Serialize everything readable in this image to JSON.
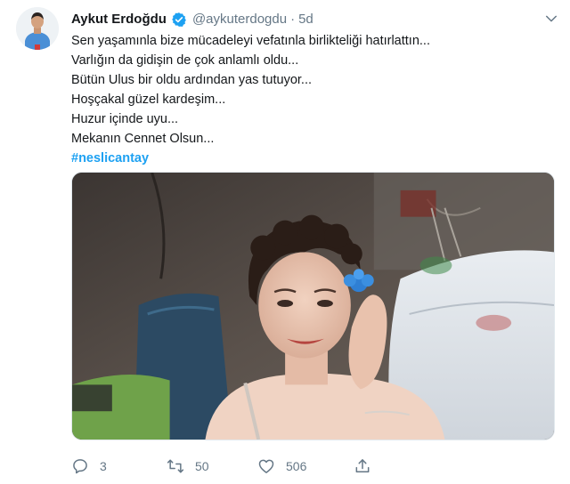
{
  "tweet": {
    "author": {
      "name": "Aykut Erdoğdu",
      "handle": "@aykuterdogdu",
      "verified": true,
      "avatar_icon": "person-avatar-icon"
    },
    "separator": "·",
    "time": "5d",
    "text_lines": [
      "Sen yaşamınla bize mücadeleyi vefatınla birlikteliği hatırlattın...",
      "Varlığın da gidişin de çok anlamlı oldu...",
      "Bütün Ulus bir oldu ardından yas tutuyor...",
      "Hoşçakal güzel kardeşim...",
      "Huzur içinde uyu...",
      "Mekanın Cennet Olsun..."
    ],
    "hashtag": "#neslicantay",
    "media": {
      "icon": "photo-woman-hospital-room"
    },
    "actions": {
      "reply": {
        "icon": "reply-icon",
        "count": "3"
      },
      "retweet": {
        "icon": "retweet-icon",
        "count": "50"
      },
      "like": {
        "icon": "heart-icon",
        "count": "506"
      },
      "share": {
        "icon": "share-icon"
      }
    },
    "colors": {
      "link_blue": "#1da1f2",
      "secondary_text": "#657786",
      "primary_text": "#14171a"
    }
  }
}
